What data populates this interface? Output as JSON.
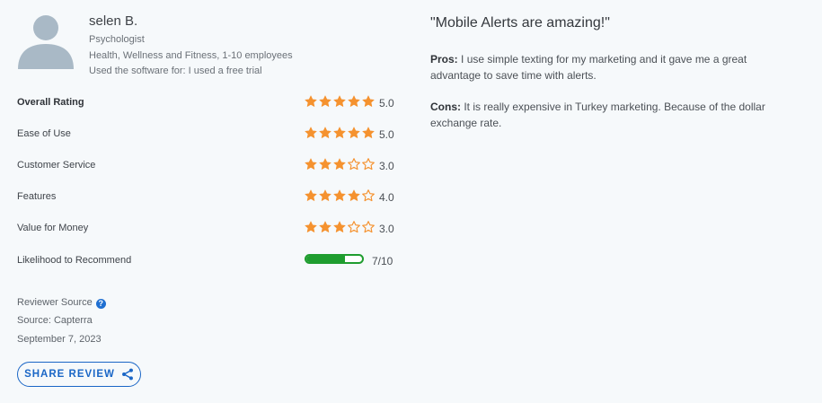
{
  "reviewer": {
    "name": "selen B.",
    "role": "Psychologist",
    "industry": "Health, Wellness and Fitness, 1-10 employees",
    "usage": "Used the software for: I used a free trial"
  },
  "ratings": [
    {
      "label": "Overall Rating",
      "score": "5.0",
      "stars": 5,
      "bold": true
    },
    {
      "label": "Ease of Use",
      "score": "5.0",
      "stars": 5
    },
    {
      "label": "Customer Service",
      "score": "3.0",
      "stars": 3
    },
    {
      "label": "Features",
      "score": "4.0",
      "stars": 4
    },
    {
      "label": "Value for Money",
      "score": "3.0",
      "stars": 3
    }
  ],
  "recommend": {
    "label": "Likelihood to Recommend",
    "value": "7/10",
    "fraction": 0.7
  },
  "source": {
    "reviewer_source": "Reviewer Source",
    "source": "Source: Capterra",
    "date": "September 7, 2023"
  },
  "share_label": "SHARE REVIEW",
  "review": {
    "title": "\"Mobile Alerts are amazing!\"",
    "pros_label": "Pros:",
    "pros": "I use simple texting for my marketing and it gave me a great advantage to save time with alerts.",
    "cons_label": "Cons:",
    "cons": "It is really expensive in Turkey marketing. Because of the dollar exchange rate."
  },
  "colors": {
    "star": "#f5922f",
    "bar": "#1f9d2f",
    "link": "#1a66c6"
  },
  "icons": {
    "avatar": "user-avatar-icon",
    "help": "question-circle-icon",
    "share": "share-icon"
  }
}
